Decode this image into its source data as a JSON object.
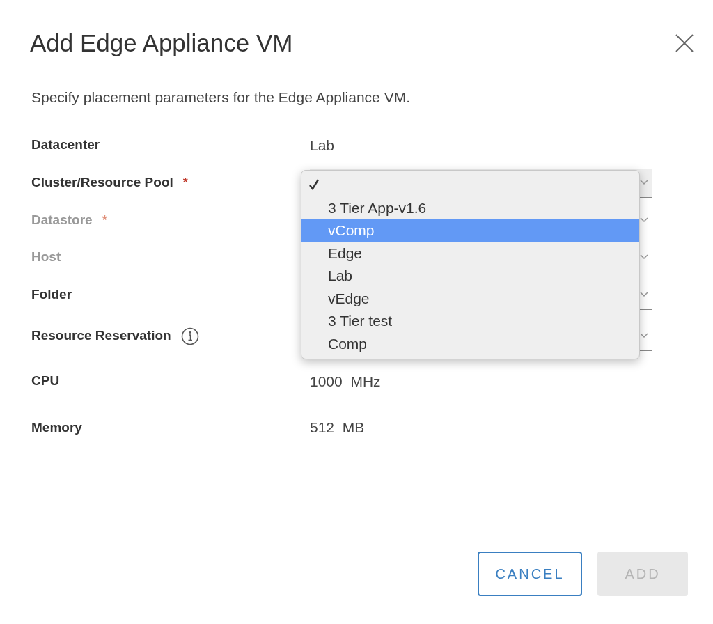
{
  "dialog": {
    "title": "Add Edge Appliance VM",
    "description": "Specify placement parameters for the Edge Appliance VM.",
    "fields": [
      {
        "label": "Datacenter",
        "kind": "text",
        "value": "Lab",
        "disabled": false
      },
      {
        "label": "Cluster/Resource Pool",
        "kind": "select",
        "required_mark": "*",
        "disabled": false
      },
      {
        "label": "Datastore",
        "kind": "select",
        "required_mark": "*",
        "disabled": true
      },
      {
        "label": "Host",
        "kind": "select",
        "disabled": true
      },
      {
        "label": "Folder",
        "kind": "select",
        "disabled": false
      },
      {
        "label": "Resource Reservation",
        "kind": "select",
        "info": true,
        "disabled": false
      },
      {
        "label": "CPU",
        "kind": "text",
        "value": "1000  MHz",
        "disabled": false
      },
      {
        "label": "Memory",
        "kind": "text",
        "value": "512  MB",
        "disabled": false
      }
    ],
    "dropdown": {
      "options": [
        {
          "checked": true,
          "highlighted": false
        },
        {
          "label": "3 Tier App-v1.6",
          "checked": false,
          "highlighted": false
        },
        {
          "label": "vComp",
          "checked": false,
          "highlighted": true
        },
        {
          "label": "Edge",
          "checked": false,
          "highlighted": false
        },
        {
          "label": "Lab",
          "checked": false,
          "highlighted": false
        },
        {
          "label": "vEdge",
          "checked": false,
          "highlighted": false
        },
        {
          "label": "3 Tier test",
          "checked": false,
          "highlighted": false
        },
        {
          "label": "Comp",
          "checked": false,
          "highlighted": false
        }
      ]
    },
    "buttons": [
      {
        "label": "CANCEL",
        "kind": "outline",
        "disabled": false
      },
      {
        "label": "ADD",
        "kind": "primary",
        "disabled": true
      }
    ]
  }
}
